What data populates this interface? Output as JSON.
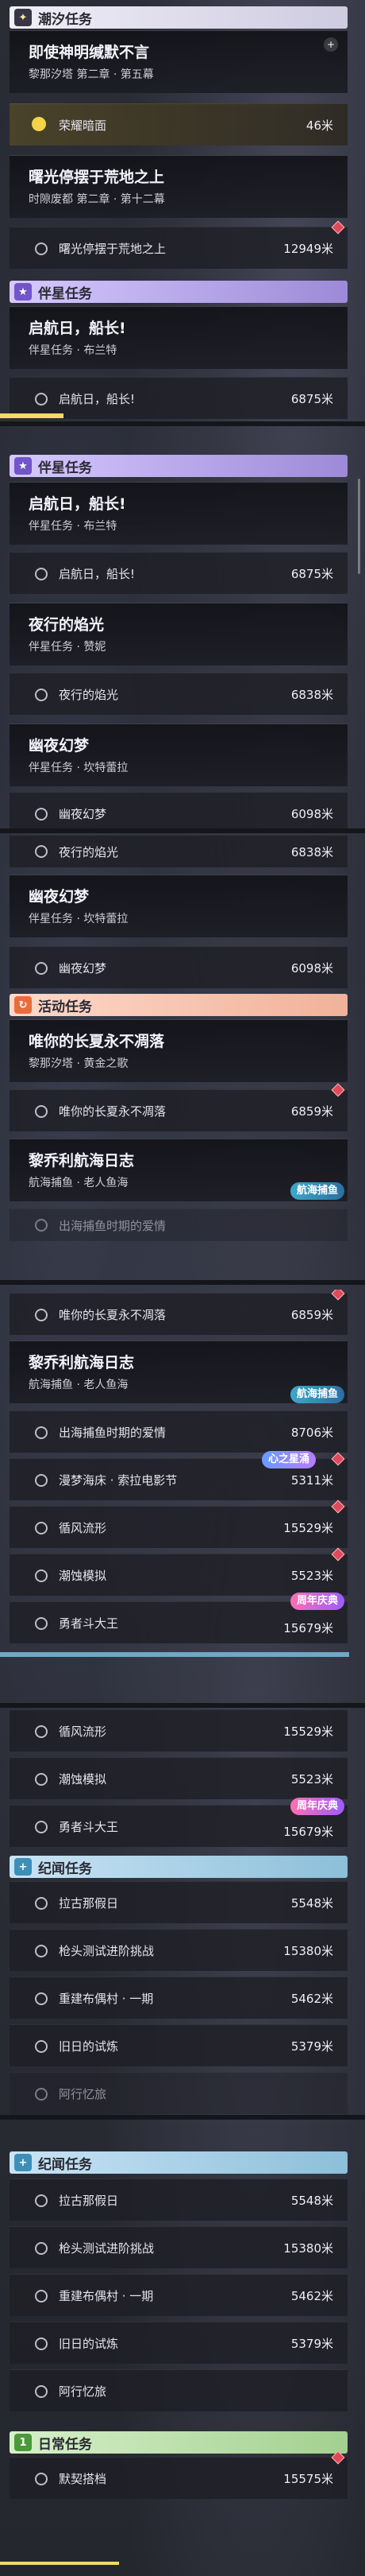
{
  "sections": {
    "tide": "潮汐任务",
    "companion": "伴星任务",
    "activity": "活动任务",
    "epoch": "纪闻任务",
    "daily": "日常任务"
  },
  "quests": {
    "silence": {
      "title": "即使神明缄默不言",
      "sub": "黎那汐塔 第二章 · 第五幕"
    },
    "glory": {
      "label": "荣耀暗面",
      "dist": "46米"
    },
    "dawn": {
      "title": "曙光停摆于荒地之上",
      "sub": "时隙废都 第二章 · 第十二幕",
      "label": "曙光停摆于荒地之上",
      "dist": "12949米"
    },
    "sail": {
      "title": "启航日，船长!",
      "sub": "伴星任务 · 布兰特",
      "label": "启航日，船长!",
      "dist": "6875米"
    },
    "night": {
      "title": "夜行的焰光",
      "sub": "伴星任务 · 赞妮",
      "label": "夜行的焰光",
      "dist": "6838米"
    },
    "dream": {
      "title": "幽夜幻梦",
      "sub": "伴星任务 · 坎特蕾拉",
      "label": "幽夜幻梦",
      "dist": "6098米"
    },
    "summer": {
      "title": "唯你的长夏永不凋落",
      "sub": "黎那汐塔 · 黄金之歌",
      "label": "唯你的长夏永不凋落",
      "dist": "6859米"
    },
    "log": {
      "title": "黎乔利航海日志",
      "sub": "航海捕鱼 · 老人鱼海",
      "label": "出海捕鱼时期的爱情",
      "dist": "8706米"
    },
    "film": {
      "label": "漫梦海床 · 索拉电影节",
      "dist": "5311米"
    },
    "wind": {
      "label": "循风流形",
      "dist": "15529米"
    },
    "tidesim": {
      "label": "潮蚀模拟",
      "dist": "5523米"
    },
    "king": {
      "label": "勇者斗大王",
      "dist": "15679米"
    },
    "vacation": {
      "label": "拉古那假日",
      "dist": "5548米"
    },
    "gun": {
      "label": "枪头测试进阶挑战",
      "dist": "15380米"
    },
    "doll": {
      "label": "重建布偶村 · 一期",
      "dist": "5462米"
    },
    "trial": {
      "label": "旧日的试炼",
      "dist": "5379米"
    },
    "memory": {
      "label": "阿行忆旅"
    },
    "daily": {
      "label": "默契搭档",
      "dist": "15575米"
    },
    "partial": {
      "label": "出海捕鱼时期的爱情"
    }
  },
  "tags": {
    "fish": "航海捕鱼",
    "anni": "周年庆典",
    "dream": "心之星涌"
  },
  "icons": {
    "tide": "diamond-star-icon",
    "companion": "star-icon",
    "activity": "refresh-icon",
    "epoch": "plus-icon",
    "daily": "one-icon",
    "glory": "gold-target-icon",
    "row": "circle-icon",
    "alert": "red-diamond-icon"
  },
  "colors": {
    "tide_header": "#f0eef7",
    "companion_header": "#9d8ad8",
    "activity_header": "#f0b29a",
    "epoch_header": "#8dbfd9",
    "daily_header": "#a3d090",
    "gold": "#f3d34a",
    "alert": "#e04a58"
  }
}
